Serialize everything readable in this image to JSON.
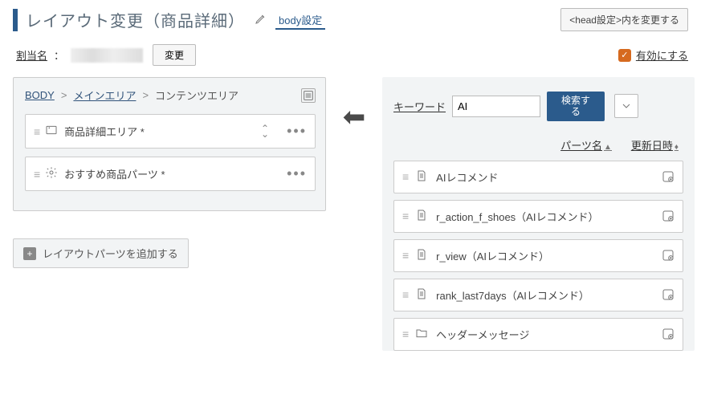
{
  "header": {
    "title": "レイアウト変更（商品詳細）",
    "tab_body": "body設定",
    "head_button": "<head設定>内を変更する"
  },
  "assign": {
    "label": "割当名",
    "change_btn": "変更",
    "enable_label": "有効にする"
  },
  "breadcrumb": {
    "body": "BODY",
    "main_area": "メインエリア",
    "content_area": "コンテンツエリア"
  },
  "layout_items": [
    {
      "label": "商品詳細エリア *"
    },
    {
      "label": "おすすめ商品パーツ *"
    }
  ],
  "add_part_btn": "レイアウトパーツを追加する",
  "search": {
    "label": "キーワード",
    "value": "AI",
    "button": "検索する"
  },
  "sort_headers": {
    "parts_name": "パーツ名",
    "updated": "更新日時"
  },
  "parts": [
    {
      "label": "AIレコメンド",
      "type": "doc"
    },
    {
      "label": "r_action_f_shoes（AIレコメンド）",
      "type": "doc"
    },
    {
      "label": "r_view（AIレコメンド）",
      "type": "doc"
    },
    {
      "label": "rank_last7days（AIレコメンド）",
      "type": "doc"
    },
    {
      "label": "ヘッダーメッセージ",
      "type": "folder"
    }
  ]
}
